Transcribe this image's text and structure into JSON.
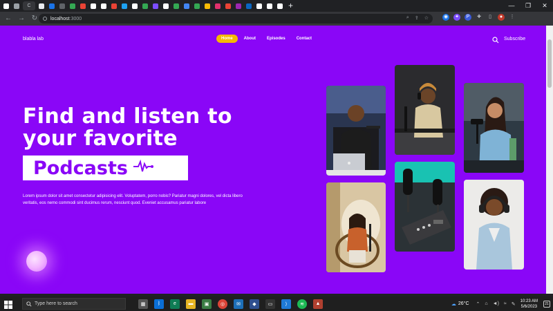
{
  "browser": {
    "tab_count": 27,
    "active_tab_index": 2,
    "active_tab_glyph": "C",
    "new_tab": "+",
    "address": {
      "host": "localhost",
      "port": ":3000"
    },
    "window_controls": [
      "—",
      "❐",
      "✕"
    ]
  },
  "site": {
    "brand": "blabla lab",
    "nav": [
      {
        "label": "Home",
        "active": true
      },
      {
        "label": "About",
        "active": false
      },
      {
        "label": "Episodes",
        "active": false
      },
      {
        "label": "Contact",
        "active": false
      }
    ],
    "subscribe": "Subscribe",
    "hero": {
      "title_line1": "Find and listen to",
      "title_line2": "your favorite",
      "highlight": "Podcasts",
      "description": "Lorem ipsum dolor sit amet consectetur adipisicing elit. Voluptatem, porro nobis? Pariatur magni dolores, vel dicta libero veritatis, eos nemo commodi sint ducimus rerum, nesciunt quod. Eveniet accusamus pariatur labore"
    },
    "colors": {
      "background": "#8a06f7",
      "accent": "#f5b800",
      "text": "#ffffff"
    },
    "photos": [
      {
        "name": "man-laptop-mic",
        "icon": "photo-icon"
      },
      {
        "name": "woman-headphones-mic",
        "icon": "photo-icon"
      },
      {
        "name": "woman-smiling-mic",
        "icon": "photo-icon"
      },
      {
        "name": "woman-chair-mic",
        "icon": "photo-icon"
      },
      {
        "name": "mixer-equipment",
        "icon": "photo-icon"
      },
      {
        "name": "woman-headphones-smiling",
        "icon": "photo-icon"
      }
    ]
  },
  "taskbar": {
    "search_placeholder": "Type here to search",
    "weather": "26°C",
    "time": "10:23 AM",
    "date": "5/6/2023",
    "notification_count": "21"
  }
}
